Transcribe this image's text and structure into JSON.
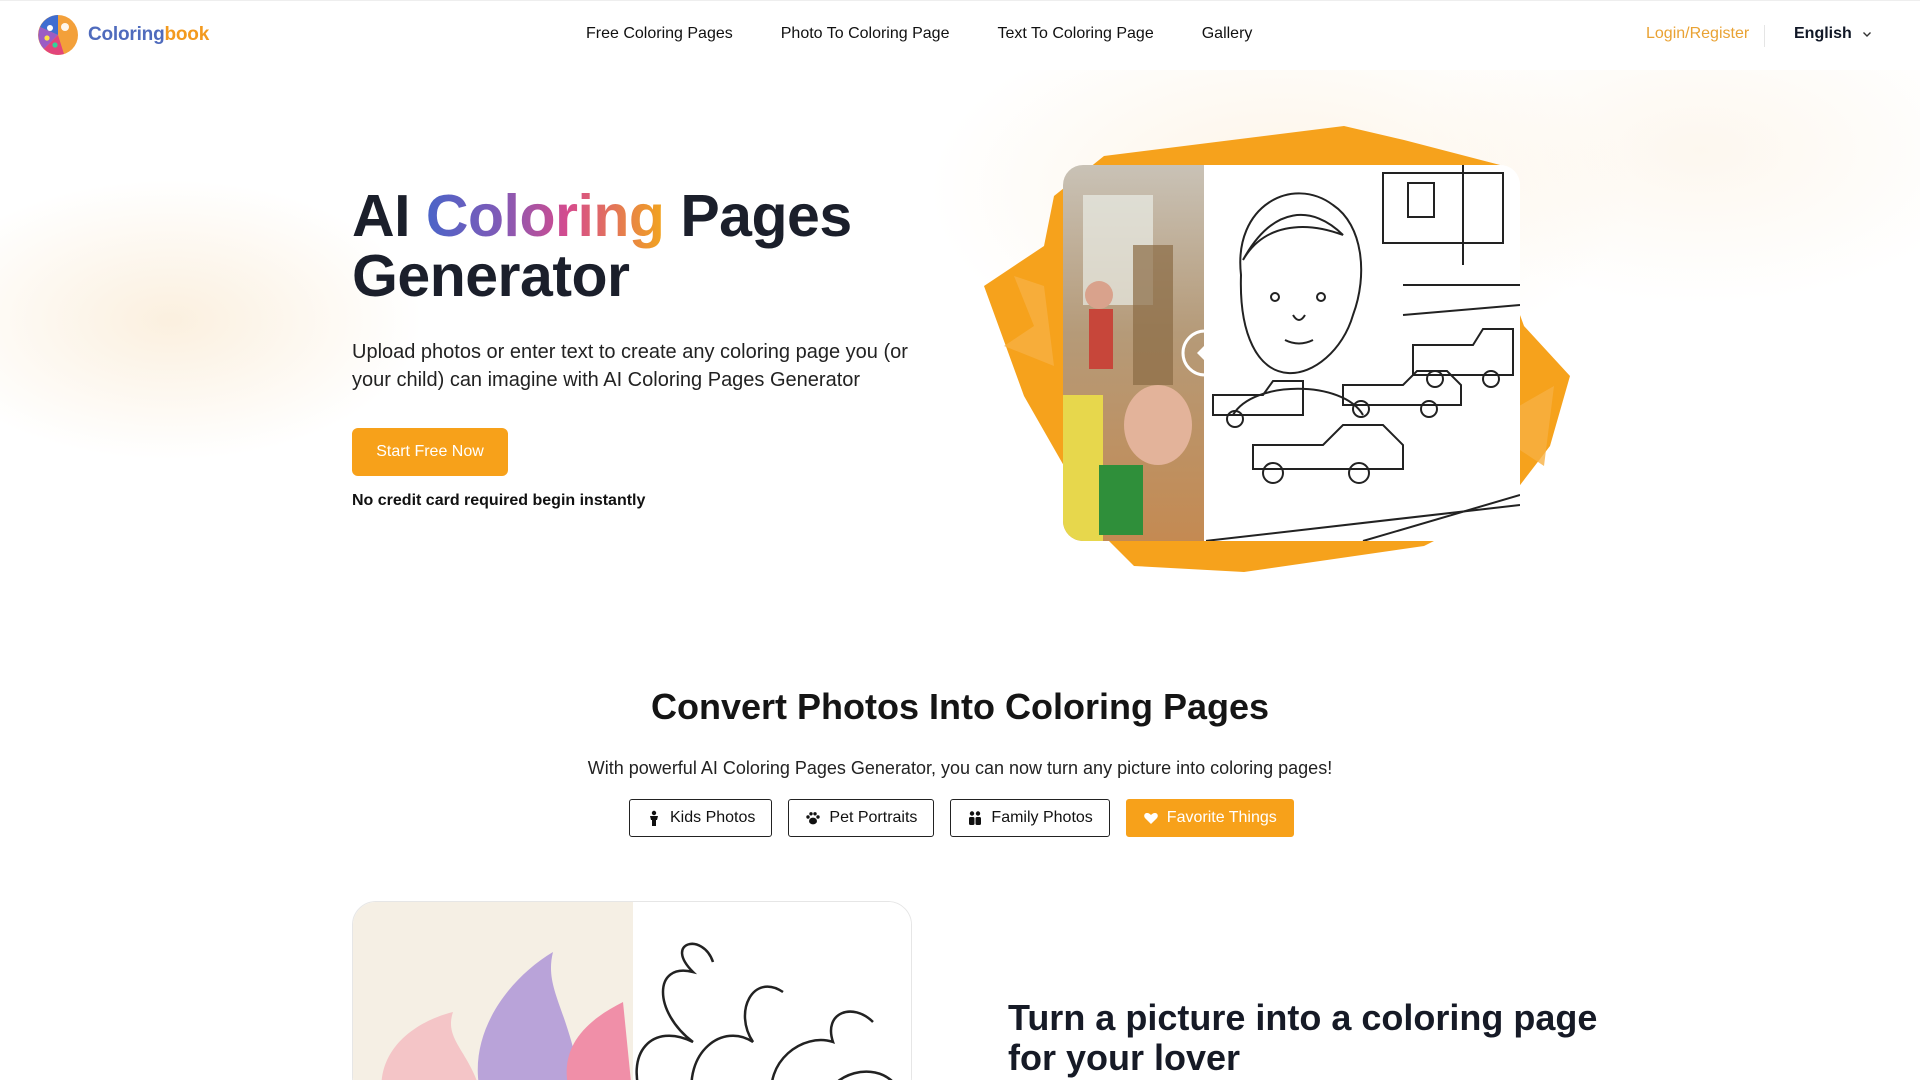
{
  "brand": {
    "logo_text_part1": "Coloring",
    "logo_text_part2": "book"
  },
  "nav": {
    "items": [
      "Free Coloring Pages",
      "Photo To Coloring Page",
      "Text To Coloring Page",
      "Gallery"
    ],
    "login": "Login/Register",
    "language": "English"
  },
  "hero": {
    "title_part1": "AI ",
    "title_highlight": "Coloring",
    "title_part2": " Pages",
    "title_line2": "Generator",
    "subtitle": "Upload photos or enter text to create any coloring page you (or your child) can imagine with AI Coloring Pages Generator",
    "cta_label": "Start Free Now",
    "cta_note": "No credit card required begin instantly"
  },
  "convert": {
    "title": "Convert Photos Into Coloring Pages",
    "subtitle": "With powerful AI Coloring Pages Generator, you can now turn any picture into coloring pages!",
    "tabs": [
      {
        "label": "Kids Photos",
        "icon": "child-icon",
        "active": false
      },
      {
        "label": "Pet Portraits",
        "icon": "paw-icon",
        "active": false
      },
      {
        "label": "Family Photos",
        "icon": "family-icon",
        "active": false
      },
      {
        "label": "Favorite Things",
        "icon": "heart-icon",
        "active": true
      }
    ],
    "demo_title": "Turn a picture into a coloring page for your lover"
  },
  "colors": {
    "accent": "#f7a11a",
    "login": "#e9a233",
    "brand_blue": "#4f6bbd"
  }
}
